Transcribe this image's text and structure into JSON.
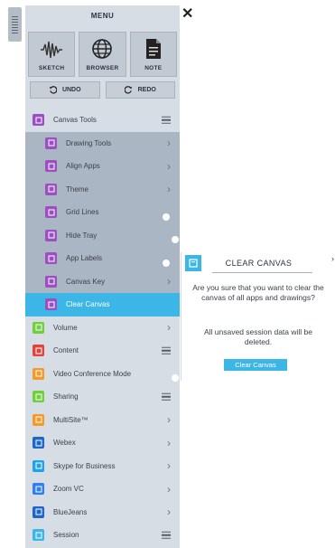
{
  "menu": {
    "title": "MENU",
    "close_symbol": "✕",
    "tools": [
      {
        "label": "SKETCH",
        "icon": "sketch-waveform-icon"
      },
      {
        "label": "BROWSER",
        "icon": "globe-icon"
      },
      {
        "label": "NOTE",
        "icon": "note-document-icon"
      }
    ],
    "undo_label": "UNDO",
    "redo_label": "REDO"
  },
  "items": [
    {
      "label": "Canvas Tools",
      "level": "top",
      "icon_color": "#9b4fc0",
      "trail": "list"
    },
    {
      "label": "Drawing Tools",
      "level": "sub",
      "icon_color": "#9b4fc0",
      "trail": "chevron"
    },
    {
      "label": "Align Apps",
      "level": "sub",
      "icon_color": "#9b4fc0",
      "trail": "chevron"
    },
    {
      "label": "Theme",
      "level": "sub",
      "icon_color": "#9b4fc0",
      "trail": "chevron"
    },
    {
      "label": "Grid Lines",
      "level": "sub",
      "icon_color": "#9b4fc0",
      "trail": "toggle-on"
    },
    {
      "label": "Hide Tray",
      "level": "sub",
      "icon_color": "#9b4fc0",
      "trail": "toggle-off"
    },
    {
      "label": "App Labels",
      "level": "sub",
      "icon_color": "#9b4fc0",
      "trail": "toggle-on"
    },
    {
      "label": "Canvas Key",
      "level": "sub",
      "icon_color": "#9b4fc0",
      "trail": "chevron"
    },
    {
      "label": "Clear Canvas",
      "level": "sub",
      "icon_color": "#9b4fc0",
      "trail": "none",
      "active": true
    },
    {
      "label": "Volume",
      "level": "top",
      "icon_color": "#6fcf3f",
      "trail": "chevron"
    },
    {
      "label": "Content",
      "level": "top",
      "icon_color": "#e0443f",
      "trail": "list"
    },
    {
      "label": "Video Conference Mode",
      "level": "top",
      "icon_color": "#f39a2a",
      "trail": "toggle-off"
    },
    {
      "label": "Sharing",
      "level": "top",
      "icon_color": "#6fcf3f",
      "trail": "list"
    },
    {
      "label": "MultiSite™",
      "level": "top",
      "icon_color": "#f39a2a",
      "trail": "chevron"
    },
    {
      "label": "Webex",
      "level": "top",
      "icon_color": "#1f66c9",
      "trail": "chevron"
    },
    {
      "label": "Skype for Business",
      "level": "top",
      "icon_color": "#1fa3e6",
      "trail": "chevron"
    },
    {
      "label": "Zoom VC",
      "level": "top",
      "icon_color": "#2f7ff0",
      "trail": "chevron"
    },
    {
      "label": "BlueJeans",
      "level": "top",
      "icon_color": "#1f66c9",
      "trail": "chevron"
    },
    {
      "label": "Session",
      "level": "top",
      "icon_color": "#3bb6e7",
      "trail": "list"
    }
  ],
  "popup": {
    "title": "CLEAR CANVAS",
    "question": "Are you sure that you want to clear the canvas of all apps and drawings?",
    "warning": "All unsaved session data will be deleted.",
    "button_label": "Clear Canvas"
  },
  "colors": {
    "accent": "#3bb6e7",
    "canvas_tools": "#9b4fc0"
  }
}
